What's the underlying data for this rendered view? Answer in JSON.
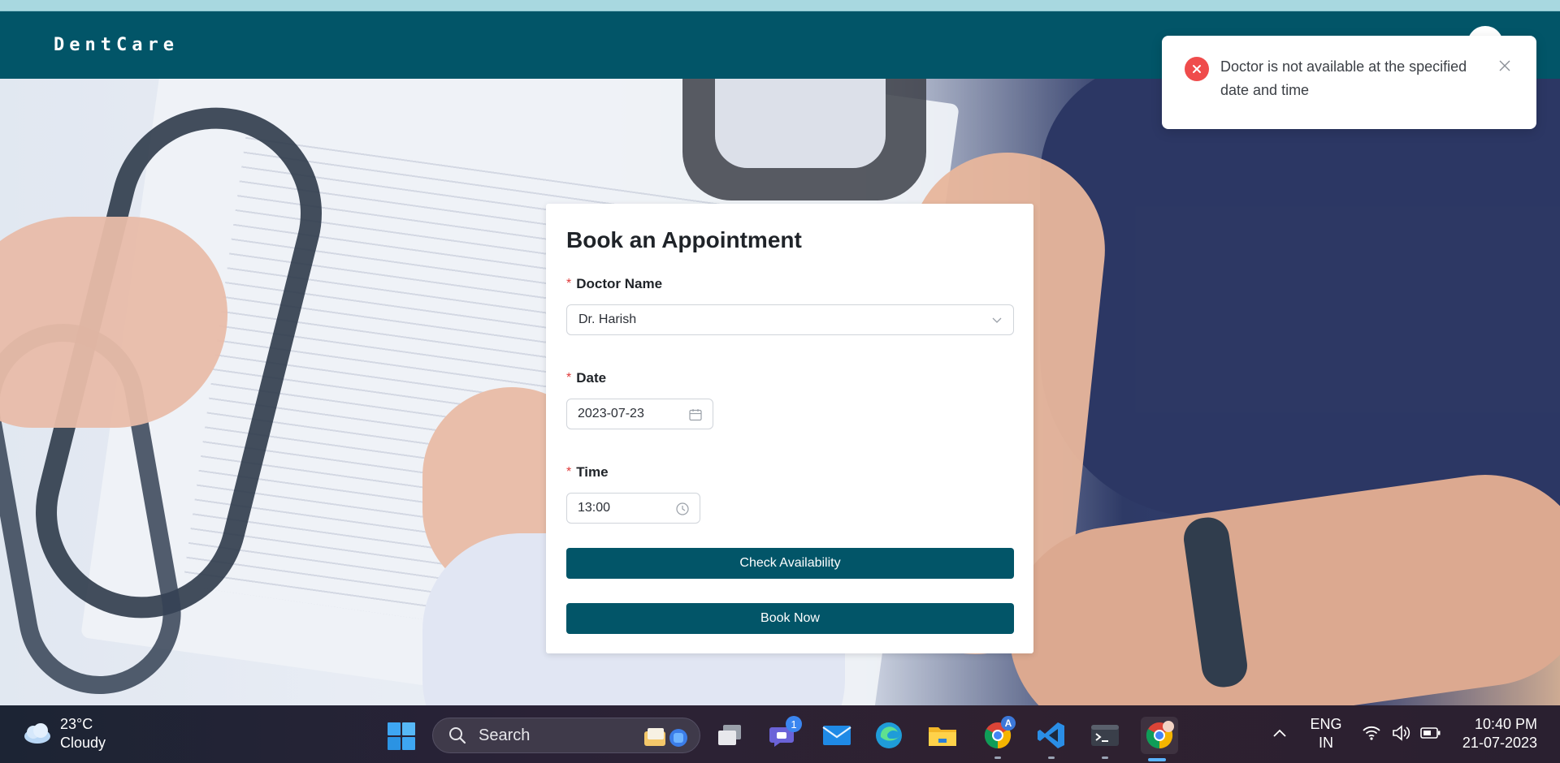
{
  "app": {
    "brand": "DentCare"
  },
  "form": {
    "title": "Book an Appointment",
    "doctor": {
      "label": "Doctor Name",
      "value": "Dr. Harish"
    },
    "date": {
      "label": "Date",
      "value": "2023-07-23"
    },
    "time": {
      "label": "Time",
      "value": "13:00"
    },
    "required_marker": "*",
    "check_button": "Check Availability",
    "book_button": "Book Now"
  },
  "toast": {
    "type": "error",
    "message": "Doctor is not available at the specified date and time"
  },
  "taskbar": {
    "weather": {
      "temp": "23°C",
      "condition": "Cloudy"
    },
    "search_placeholder": "Search",
    "teams_badge": "1",
    "chrome_badge": "A",
    "language": {
      "line1": "ENG",
      "line2": "IN"
    },
    "time": "10:40 PM",
    "date": "21-07-2023",
    "apps": [
      "windows-start",
      "search",
      "task-view",
      "teams-chat",
      "mail",
      "edge",
      "file-explorer",
      "chrome",
      "vscode",
      "terminal",
      "chrome-profile"
    ]
  },
  "colors": {
    "primary": "#025568",
    "error": "#ef4c4c",
    "required": "#e03b3b"
  }
}
